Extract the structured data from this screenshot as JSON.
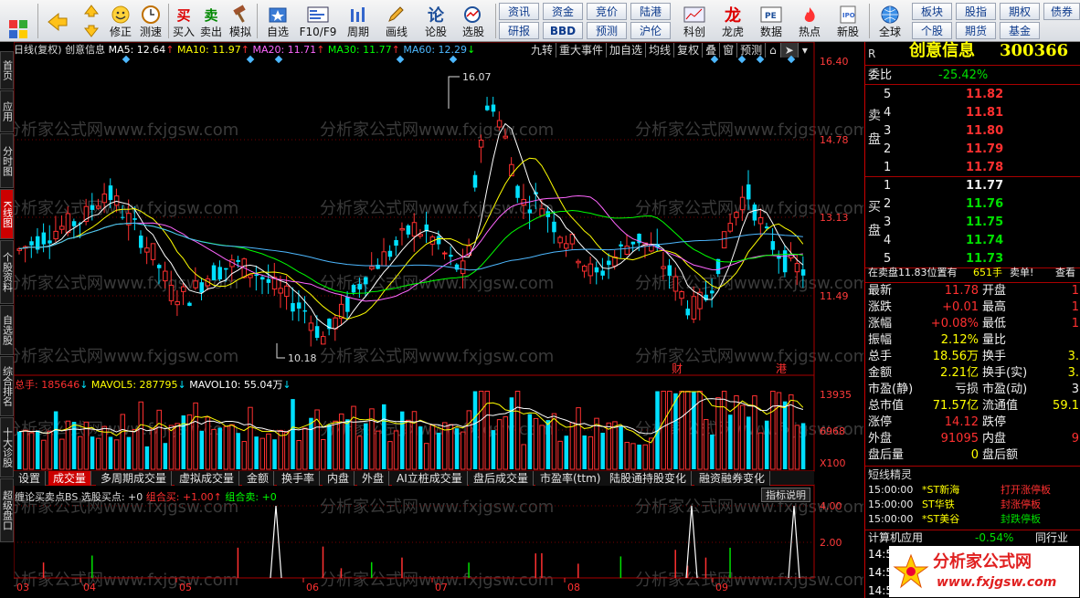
{
  "toolbar": {
    "buttons": [
      {
        "name": "windows-button",
        "label": "",
        "icon": "windows-icon"
      },
      {
        "name": "back-button",
        "label": "",
        "icon": "back-arrow-icon"
      },
      {
        "name": "up-button",
        "label": "",
        "icon": "up-arrow-icon"
      },
      {
        "name": "down-button",
        "label": "",
        "icon": "down-arrow-icon"
      },
      {
        "name": "modify-button",
        "label": "修正",
        "icon": "smile-icon"
      },
      {
        "name": "backtest-button",
        "label": "测速",
        "icon": "clock-icon"
      },
      {
        "name": "buy-button",
        "label": "买入",
        "icon": "buy-icon"
      },
      {
        "name": "sell-button",
        "label": "卖出",
        "icon": "sell-icon"
      },
      {
        "name": "simulate-button",
        "label": "模拟",
        "icon": "hammer-icon"
      },
      {
        "name": "favorites-button",
        "label": "自选",
        "icon": "favorite-icon"
      },
      {
        "name": "f10-button",
        "label": "F10/F9",
        "icon": "f10-icon"
      },
      {
        "name": "period-button",
        "label": "周期",
        "icon": "period-icon"
      },
      {
        "name": "draw-button",
        "label": "画线",
        "icon": "pencil-icon"
      },
      {
        "name": "stock-forum-button",
        "label": "论股",
        "icon": "forum-icon"
      },
      {
        "name": "select-stock-button",
        "label": "选股",
        "icon": "select-icon"
      },
      {
        "name": "kechuang-button",
        "label": "科创",
        "icon": "kechuang-icon"
      },
      {
        "name": "longhu-button",
        "label": "龙虎",
        "icon": "dragon-icon"
      },
      {
        "name": "data-button",
        "label": "数据",
        "icon": "pe-icon"
      },
      {
        "name": "hotspot-button",
        "label": "热点",
        "icon": "hot-icon"
      },
      {
        "name": "new-stock-button",
        "label": "新股",
        "icon": "ipo-icon"
      },
      {
        "name": "global-button",
        "label": "全球",
        "icon": "globe-icon"
      }
    ],
    "grid_buttons": [
      {
        "label": "资讯"
      },
      {
        "label": "资金"
      },
      {
        "label": "竞价"
      },
      {
        "label": "陆港"
      },
      {
        "label": "研报"
      },
      {
        "label": "BBD"
      },
      {
        "label": "预测"
      },
      {
        "label": "沪伦"
      },
      {
        "label": "板块"
      },
      {
        "label": "股指"
      },
      {
        "label": "期权"
      },
      {
        "label": "债券"
      },
      {
        "label": "个股"
      },
      {
        "label": "期货"
      },
      {
        "label": "基金"
      }
    ]
  },
  "left_tabs": [
    "首页",
    "应用",
    "分时图",
    "K线图",
    "个股资料",
    "自选股",
    "综合排名",
    "十大诊股",
    "超级盘口"
  ],
  "chart_header": {
    "title": "日线(复权)",
    "stock": "创意信息",
    "ma5": "MA5: 12.64",
    "ma10": "MA10: 11.97",
    "ma20": "MA20: 11.71",
    "ma30": "MA30: 11.77",
    "ma60": "MA60: 12.29",
    "buttons": [
      "九转",
      "重大事件",
      "加自选",
      "均线",
      "复权",
      "叠",
      "窗",
      "预测"
    ]
  },
  "price_axis": [
    "16.40",
    "14.78",
    "13.13",
    "11.49"
  ],
  "annotations": {
    "high": "16.07",
    "low": "10.18",
    "fin": "财",
    "hk": "港"
  },
  "volume_header": {
    "total": "总手: 185646",
    "mavol5": "MAVOL5: 287795",
    "mavol10": "MAVOL10: 55.04万"
  },
  "volume_axis": [
    "13935",
    "6968",
    "X100"
  ],
  "indicator_tabs": [
    "设置",
    "成交量",
    "多周期成交量",
    "虚拟成交量",
    "金额",
    "换手率",
    "内盘",
    "外盘",
    "AI立桩成交量",
    "盘后成交量",
    "市盈率(ttm)",
    "陆股通持股变化",
    "融资融券变化"
  ],
  "bs_header": {
    "name": "缠论买卖点BS 选股买点: +0",
    "combo_buy": "组合买: +1.00",
    "combo_sell": "组合卖: +0",
    "explain": "指标说明"
  },
  "bs_axis": [
    "4.00",
    "2.00"
  ],
  "months": [
    "03",
    "04",
    "05",
    "06",
    "07",
    "08",
    "09"
  ],
  "watermark": "分析家公式网www.fxjgsw.com",
  "right": {
    "code_label": "R",
    "name": "创意信息",
    "code": "300366",
    "weibi_label": "委比",
    "weibi": "-25.42%",
    "sell_label": "卖盘",
    "buy_label": "买盘",
    "sells": [
      {
        "lvl": "5",
        "price": "11.82"
      },
      {
        "lvl": "4",
        "price": "11.81"
      },
      {
        "lvl": "3",
        "price": "11.80"
      },
      {
        "lvl": "2",
        "price": "11.79"
      },
      {
        "lvl": "1",
        "price": "11.78"
      }
    ],
    "buys": [
      {
        "lvl": "1",
        "price": "11.77"
      },
      {
        "lvl": "2",
        "price": "11.76"
      },
      {
        "lvl": "3",
        "price": "11.75"
      },
      {
        "lvl": "4",
        "price": "11.74"
      },
      {
        "lvl": "5",
        "price": "11.73"
      }
    ],
    "order_info": "在卖盘11.83位置有",
    "order_qty": "651手",
    "order_tag": "卖单!",
    "order_view": "查看",
    "quotes": [
      {
        "k": "最新",
        "v": "11.78",
        "k2": "开盘",
        "v2": "1",
        "c": "red"
      },
      {
        "k": "涨跌",
        "v": "+0.01",
        "k2": "最高",
        "v2": "1",
        "c": "red"
      },
      {
        "k": "涨幅",
        "v": "+0.08%",
        "k2": "最低",
        "v2": "1",
        "c": "red"
      },
      {
        "k": "振幅",
        "v": "2.12%",
        "k2": "量比",
        "v2": "",
        "c": "yellow"
      },
      {
        "k": "总手",
        "v": "18.56万",
        "k2": "换手",
        "v2": "3.",
        "c": "yellow"
      },
      {
        "k": "金额",
        "v": "2.21亿",
        "k2": "换手(实)",
        "v2": "3.",
        "c": "yellow"
      },
      {
        "k": "市盈(静)",
        "v": "亏损",
        "k2": "市盈(动)",
        "v2": "3",
        "c": "white"
      },
      {
        "k": "总市值",
        "v": "71.57亿",
        "k2": "流通值",
        "v2": "59.1",
        "c": "yellow"
      },
      {
        "k": "涨停",
        "v": "14.12",
        "k2": "跌停",
        "v2": "",
        "c": "red"
      },
      {
        "k": "外盘",
        "v": "91095",
        "k2": "内盘",
        "v2": "9",
        "c": "red"
      },
      {
        "k": "盘后量",
        "v": "0",
        "k2": "盘后额",
        "v2": "",
        "c": "yellow"
      }
    ],
    "spirit_title": "短线精灵",
    "spirit": [
      {
        "t": "15:00:00",
        "s": "*ST新海",
        "e": "打开涨停板"
      },
      {
        "t": "15:00:00",
        "s": "ST华铁",
        "e": "封涨停板"
      },
      {
        "t": "15:00:00",
        "s": "*ST美谷",
        "e": "封跌停板"
      }
    ],
    "industry": "计算机应用",
    "industry_pct": "-0.54%",
    "industry_more": "同行业",
    "ticks": [
      "14:5",
      "14:5",
      "14:5"
    ],
    "logo_text": "分析家公式网",
    "logo_url": "www.fxjgsw.com"
  },
  "colors": {
    "up": "#ff3030",
    "down": "#00e0ff",
    "ma5": "#ffffff",
    "ma10": "#ffff00",
    "ma20": "#ff66ff",
    "ma30": "#00ff00",
    "ma60": "#4db8ff"
  }
}
